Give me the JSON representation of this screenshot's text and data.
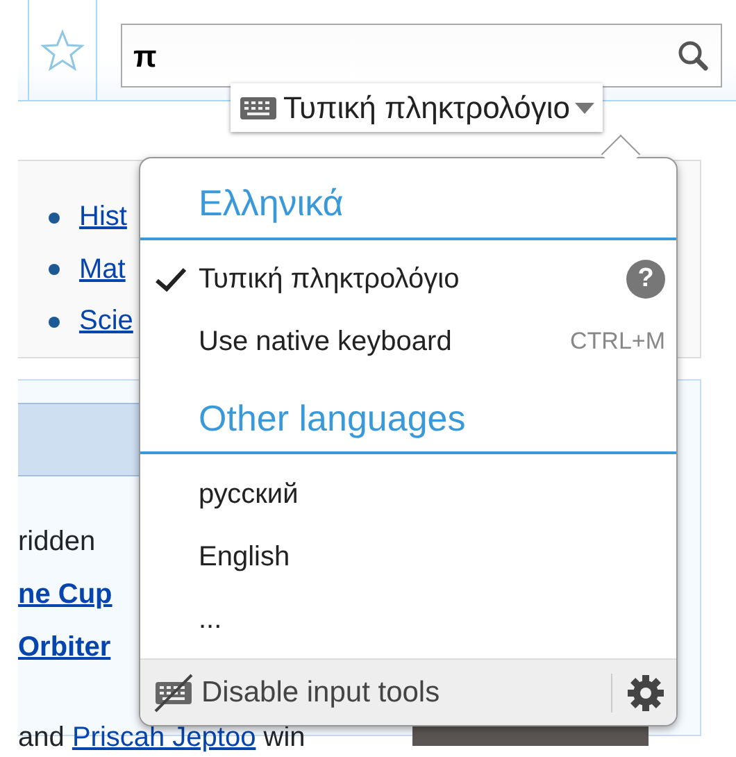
{
  "search": {
    "value": "π"
  },
  "input_tool_indicator": {
    "label": "Τυπική πληκτρολόγιο"
  },
  "background_page": {
    "portal_links": [
      "Hist",
      "Mat",
      "Scie"
    ],
    "news_lines": [
      {
        "segments": [
          {
            "text": "ridden",
            "kind": "plain"
          }
        ]
      },
      {
        "segments": [
          {
            "text": "ne Cup",
            "kind": "bold_link"
          }
        ]
      },
      {
        "segments": [
          {
            "text": "Orbiter",
            "kind": "bold_link"
          }
        ]
      },
      {
        "segments": [
          {
            "text": "and ",
            "kind": "plain"
          },
          {
            "text": "Priscah Jeptoo",
            "kind": "link"
          },
          {
            "text": " win",
            "kind": "plain"
          }
        ]
      }
    ]
  },
  "popup": {
    "sections": [
      {
        "heading": "Ελληνικά",
        "items": [
          {
            "label": "Τυπική πληκτρολόγιο",
            "selected": true,
            "help": "?"
          },
          {
            "label": "Use native keyboard",
            "selected": false,
            "shortcut": "CTRL+M"
          }
        ]
      },
      {
        "heading": "Other languages",
        "items": [
          {
            "label": "русский",
            "selected": false
          },
          {
            "label": "English",
            "selected": false
          },
          {
            "label": "...",
            "selected": false
          }
        ]
      }
    ],
    "footer": {
      "label": "Disable input tools"
    }
  }
}
